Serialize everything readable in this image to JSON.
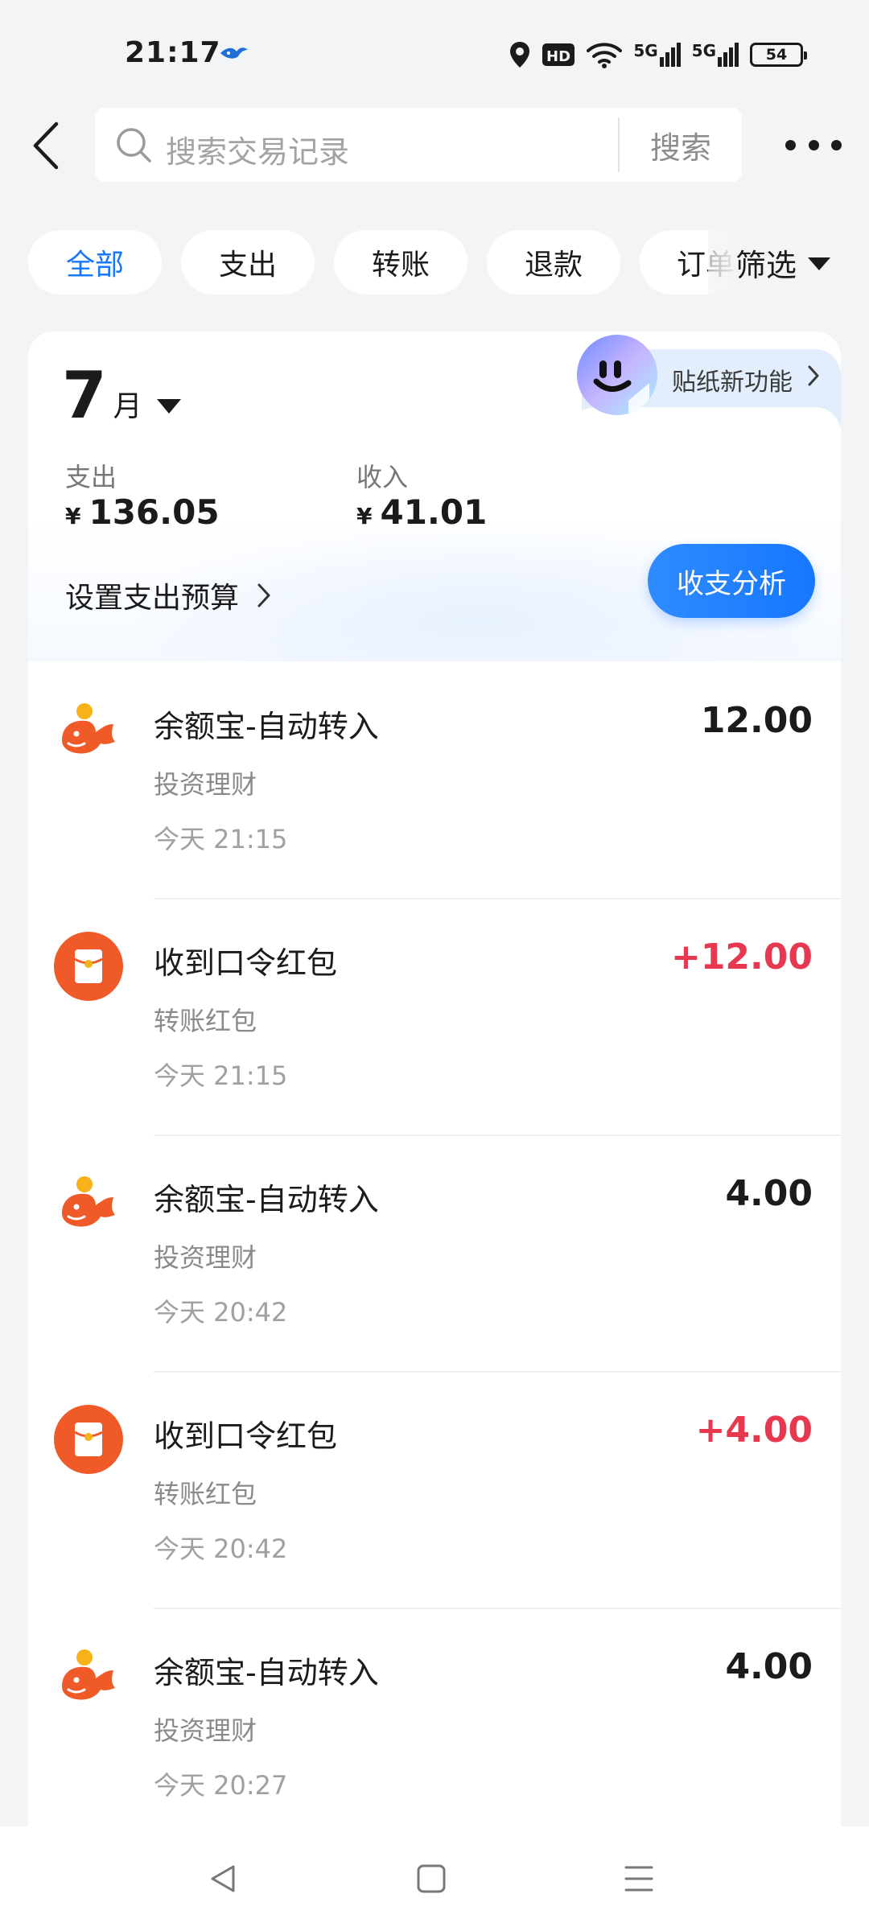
{
  "status_bar": {
    "time": "21:17",
    "network_1": "5G",
    "network_2": "5G",
    "hd_label": "HD",
    "battery": "54"
  },
  "header": {
    "search_placeholder": "搜索交易记录",
    "search_button": "搜索"
  },
  "filters": {
    "chips": [
      "全部",
      "支出",
      "转账",
      "退款",
      "订单"
    ],
    "active_index": 0,
    "filter_label": "筛选"
  },
  "summary": {
    "month_number": "7",
    "month_unit": "月",
    "sticker_label": "贴纸新功能",
    "expense_label": "支出",
    "expense_currency": "¥",
    "expense_value": "136.05",
    "income_label": "收入",
    "income_currency": "¥",
    "income_value": "41.01",
    "budget_label": "设置支出预算",
    "analysis_button": "收支分析"
  },
  "transactions": [
    {
      "title": "余额宝-自动转入",
      "category": "投资理财",
      "time": "今天 21:15",
      "amount": "12.00",
      "type": "yuebao",
      "income": false
    },
    {
      "title": "收到口令红包",
      "category": "转账红包",
      "time": "今天 21:15",
      "amount": "+12.00",
      "type": "redpacket",
      "income": true
    },
    {
      "title": "余额宝-自动转入",
      "category": "投资理财",
      "time": "今天 20:42",
      "amount": "4.00",
      "type": "yuebao",
      "income": false
    },
    {
      "title": "收到口令红包",
      "category": "转账红包",
      "time": "今天 20:42",
      "amount": "+4.00",
      "type": "redpacket",
      "income": true
    },
    {
      "title": "余额宝-自动转入",
      "category": "投资理财",
      "time": "今天 20:27",
      "amount": "4.00",
      "type": "yuebao",
      "income": false
    }
  ],
  "colors": {
    "accent": "#1677ff",
    "income": "#e8384f",
    "icon_orange": "#f05a28",
    "background": "#f3f4f6"
  },
  "icons": {
    "back": "chevron-left-icon",
    "search": "search-icon",
    "more": "more-dots-icon",
    "yuebao": "yuebao-fish-icon",
    "redpacket": "red-packet-icon",
    "nav_back": "triangle-back-icon",
    "nav_home": "square-home-icon",
    "nav_menu": "menu-lines-icon"
  }
}
